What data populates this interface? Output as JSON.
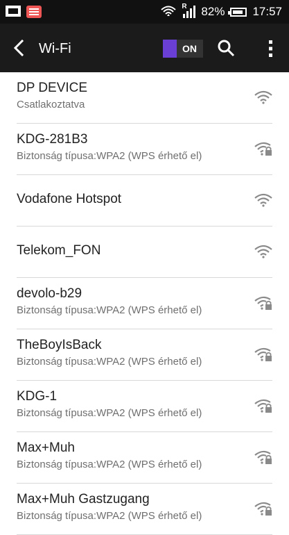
{
  "status_bar": {
    "battery_percent": "82%",
    "time": "17:57",
    "signal_indicator": "R",
    "icons": [
      "notification-square-icon",
      "app-notification-icon",
      "wifi-status-icon",
      "signal-icon",
      "battery-icon"
    ]
  },
  "toolbar": {
    "title": "Wi-Fi",
    "toggle_label": "ON",
    "accent_color": "#6a3fd6"
  },
  "networks": [
    {
      "name": "DP DEVICE",
      "status": "Csatlakoztatva",
      "secured": false
    },
    {
      "name": "KDG-281B3",
      "status": "Biztonság típusa:WPA2 (WPS érhető el)",
      "secured": true
    },
    {
      "name": "Vodafone Hotspot",
      "status": "",
      "secured": false
    },
    {
      "name": "Telekom_FON",
      "status": "",
      "secured": false
    },
    {
      "name": "devolo-b29",
      "status": "Biztonság típusa:WPA2 (WPS érhető el)",
      "secured": true
    },
    {
      "name": "TheBoyIsBack",
      "status": "Biztonság típusa:WPA2 (WPS érhető el)",
      "secured": true
    },
    {
      "name": "KDG-1",
      "status": "Biztonság típusa:WPA2 (WPS érhető el)",
      "secured": true
    },
    {
      "name": "Max+Muh",
      "status": "Biztonság típusa:WPA2 (WPS érhető el)",
      "secured": true
    },
    {
      "name": "Max+Muh Gastzugang",
      "status": "Biztonság típusa:WPA2 (WPS érhető el)",
      "secured": true
    }
  ]
}
